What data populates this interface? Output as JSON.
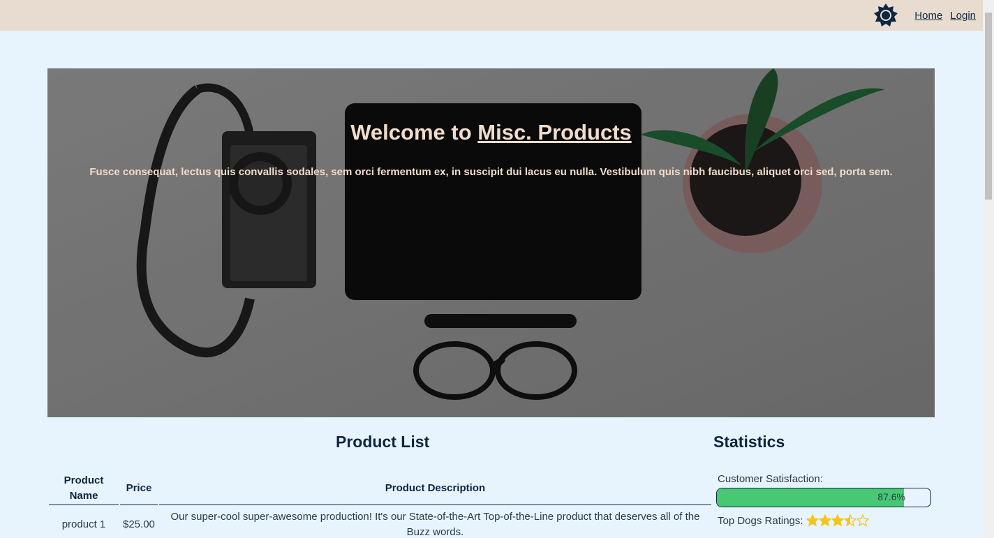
{
  "nav": {
    "theme_icon": "sun-gear-icon",
    "home_label": "Home",
    "login_label": "Login"
  },
  "hero": {
    "title_prefix": "Welcome to ",
    "title_link": "Misc. Products",
    "subtitle": "Fusce consequat, lectus quis convallis sodales, sem orci fermentum ex, in suscipit dui lacus eu nulla. Vestibulum quis nibh faucibus, aliquet orci sed, porta sem."
  },
  "product_list": {
    "title": "Product List",
    "columns": [
      "Product Name",
      "Price",
      "Product Description"
    ],
    "rows": [
      {
        "name": "product 1",
        "price": "$25.00",
        "description": "Our super-cool super-awesome production! It's our State-of-the-Art Top-of-the-Line product that deserves all of the Buzz words."
      }
    ]
  },
  "statistics": {
    "title": "Statistics",
    "satisfaction_label": "Customer Satisfaction:",
    "satisfaction_value": "87.6%",
    "satisfaction_fraction": 0.876,
    "ratings_label": "Top Dogs Ratings:",
    "rating_stars": 3.5,
    "rating_max": 5,
    "colors": {
      "progress": "#48c774",
      "star": "#f5c518"
    }
  }
}
